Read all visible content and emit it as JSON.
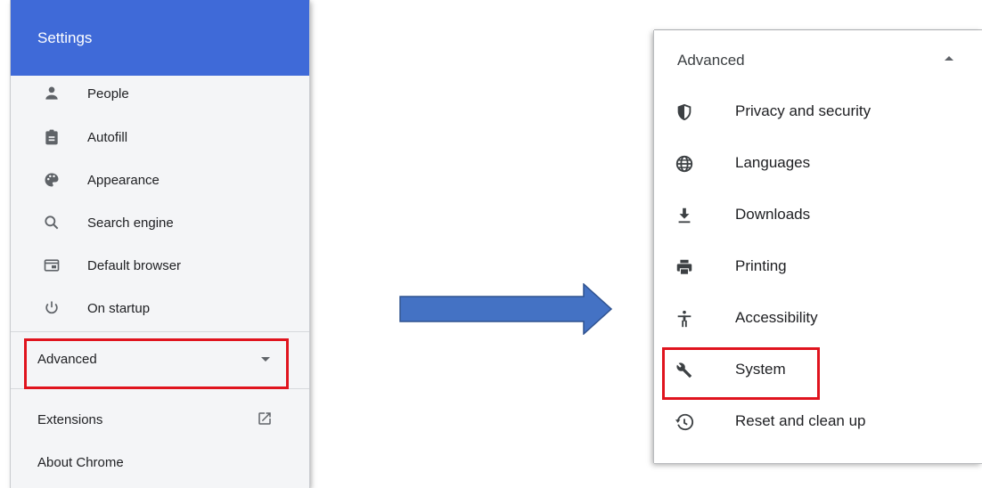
{
  "left_panel": {
    "title": "Settings",
    "items": [
      {
        "label": "People",
        "icon": "person-icon"
      },
      {
        "label": "Autofill",
        "icon": "clipboard-icon"
      },
      {
        "label": "Appearance",
        "icon": "palette-icon"
      },
      {
        "label": "Search engine",
        "icon": "search-icon"
      },
      {
        "label": "Default browser",
        "icon": "browser-window-icon"
      },
      {
        "label": "On startup",
        "icon": "power-icon"
      }
    ],
    "advanced_label": "Advanced",
    "extensions_label": "Extensions",
    "about_label": "About Chrome"
  },
  "right_panel": {
    "advanced_label": "Advanced",
    "items": [
      {
        "label": "Privacy and security",
        "icon": "shield-icon"
      },
      {
        "label": "Languages",
        "icon": "globe-icon"
      },
      {
        "label": "Downloads",
        "icon": "download-icon"
      },
      {
        "label": "Printing",
        "icon": "printer-icon"
      },
      {
        "label": "Accessibility",
        "icon": "accessibility-icon"
      },
      {
        "label": "System",
        "icon": "wrench-icon"
      },
      {
        "label": "Reset and clean up",
        "icon": "reset-history-icon"
      }
    ]
  },
  "colors": {
    "header_blue": "#3f6ad8",
    "arrow_blue": "#4472c4",
    "highlight_red": "#e0141e"
  }
}
